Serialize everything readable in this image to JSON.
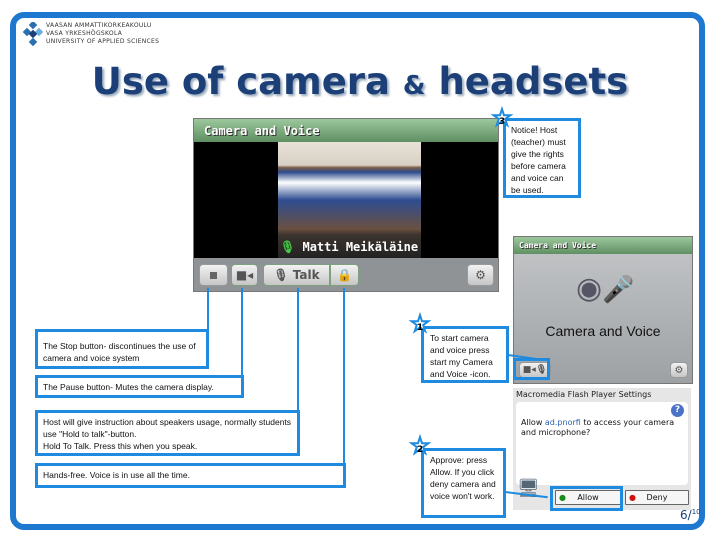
{
  "logo": {
    "lines": [
      "VAASAN AMMATTIKORKEAKOULU",
      "VASA YRKESHÖGSKOLA",
      "UNIVERSITY OF APPLIED SCIENCES"
    ]
  },
  "title": {
    "main": "Use of camera ",
    "amp": "&",
    "rest": " headsets"
  },
  "main_panel": {
    "header": "Camera and Voice",
    "user_name": "Matti Meikäläine",
    "talk_label": "Talk"
  },
  "callouts": {
    "notice": {
      "num": "3",
      "text": "Notice! Host (teacher) must give the rights before camera and voice can be used."
    },
    "start": {
      "num": "1",
      "text": "To start camera and voice press start my Camera and Voice -icon."
    },
    "approve": {
      "num": "2",
      "text": "Approve: press Allow. If you click deny camera and voice won't work."
    },
    "stop": "The Stop button- discontinues the use of camera and voice system",
    "pause": "The Pause button- Mutes the camera display.",
    "host": [
      "Host will give instruction about speakers usage, normally students use \"Hold to talk\"-button.",
      "Hold To Talk. Press this when you speak."
    ],
    "handsfree": "Hands-free. Voice is in use all the time."
  },
  "small_panel": {
    "header": "Camera and Voice",
    "caption": "Camera and Voice"
  },
  "flash_dialog": {
    "title": "Macromedia Flash Player Settings",
    "question_prefix": "Allow ",
    "site": "ad.pnorfi",
    "question_suffix": " to access your camera and microphone?",
    "allow": "Allow",
    "deny": "Deny"
  },
  "page": {
    "current": "6/",
    "total": "10"
  },
  "colors": {
    "accent": "#1e8be0",
    "frame": "#1e78d0",
    "title": "#1c3f78"
  }
}
